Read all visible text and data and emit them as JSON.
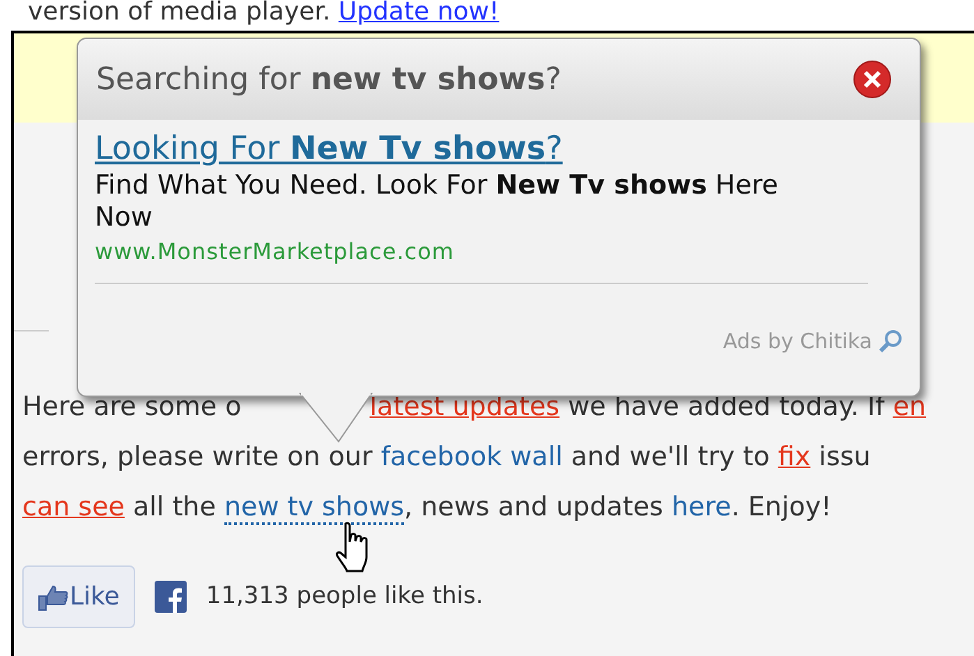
{
  "banner": {
    "text": "version of media player.",
    "link": "Update now!"
  },
  "popup": {
    "title": "Searching for **new tv shows**?",
    "ad_headline": "Looking For **New Tv shows**?",
    "ad_description": "Find What You Need. Look For **New Tv shows** Here Now",
    "ad_url": "www.MonsterMarketplace.com",
    "footer": "Ads by Chitika"
  },
  "paragraph": [
    [
      {
        "kind": "plain",
        "text": "Here are some o"
      },
      {
        "kind": "gap"
      },
      {
        "kind": "red_link",
        "text": "latest updates"
      },
      {
        "kind": "plain",
        "text": " we have added today. If "
      },
      {
        "kind": "red_link",
        "text": "en"
      }
    ],
    [
      {
        "kind": "plain",
        "text": "errors, please write on our "
      },
      {
        "kind": "blue_link",
        "text": "facebook wall"
      },
      {
        "kind": "plain",
        "text": " and we'll try to "
      },
      {
        "kind": "red_link",
        "text": "fix"
      },
      {
        "kind": "plain",
        "text": " issu"
      }
    ],
    [
      {
        "kind": "red_link",
        "text": "can see"
      },
      {
        "kind": "plain",
        "text": " all the "
      },
      {
        "kind": "dotted_link",
        "text": "new tv shows"
      },
      {
        "kind": "plain",
        "text": ", news and updates "
      },
      {
        "kind": "blue_link",
        "text": "here"
      },
      {
        "kind": "plain",
        "text": ". Enjoy!"
      }
    ]
  ],
  "like": {
    "button": "Like",
    "count": "11,313 people like this."
  }
}
